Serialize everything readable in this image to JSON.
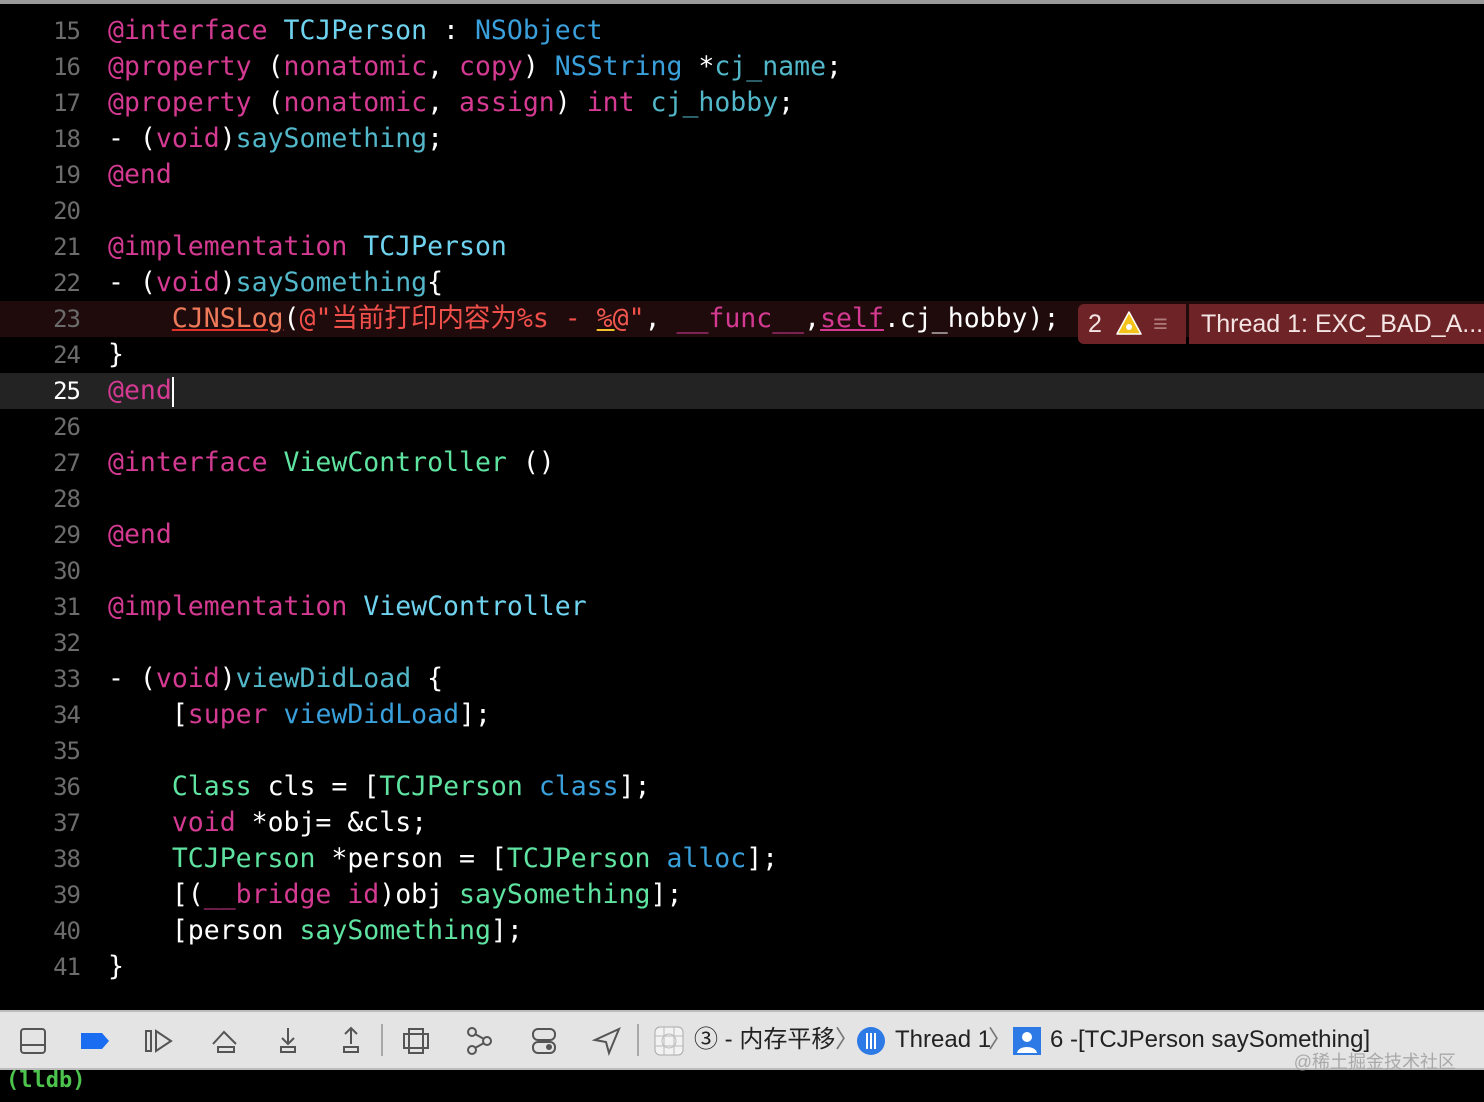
{
  "editor": {
    "lines": [
      {
        "n": "15",
        "t": [
          [
            "@interface ",
            "k"
          ],
          [
            "TCJPerson",
            "t"
          ],
          [
            " : ",
            "p"
          ],
          [
            "NSObject",
            "s"
          ]
        ]
      },
      {
        "n": "16",
        "t": [
          [
            "@property ",
            "k"
          ],
          [
            "(",
            "p"
          ],
          [
            "nonatomic",
            "k"
          ],
          [
            ", ",
            "p"
          ],
          [
            "copy",
            "k"
          ],
          [
            ") ",
            "p"
          ],
          [
            "NSString",
            "s"
          ],
          [
            " *",
            "p"
          ],
          [
            "cj_name",
            "m"
          ],
          [
            ";",
            "p"
          ]
        ]
      },
      {
        "n": "17",
        "t": [
          [
            "@property ",
            "k"
          ],
          [
            "(",
            "p"
          ],
          [
            "nonatomic",
            "k"
          ],
          [
            ", ",
            "p"
          ],
          [
            "assign",
            "k"
          ],
          [
            ") ",
            "p"
          ],
          [
            "int",
            "k"
          ],
          [
            " ",
            "p"
          ],
          [
            "cj_hobby",
            "m"
          ],
          [
            ";",
            "p"
          ]
        ]
      },
      {
        "n": "18",
        "t": [
          [
            "- (",
            "p"
          ],
          [
            "void",
            "k"
          ],
          [
            ")",
            "p"
          ],
          [
            "saySomething",
            "m"
          ],
          [
            ";",
            "p"
          ]
        ]
      },
      {
        "n": "19",
        "t": [
          [
            "@end",
            "k"
          ]
        ]
      },
      {
        "n": "20",
        "t": []
      },
      {
        "n": "21",
        "t": [
          [
            "@implementation ",
            "k"
          ],
          [
            "TCJPerson",
            "t"
          ]
        ]
      },
      {
        "n": "22",
        "t": [
          [
            "- (",
            "p"
          ],
          [
            "void",
            "k"
          ],
          [
            ")",
            "p"
          ],
          [
            "saySomething",
            "m"
          ],
          [
            "{",
            "p"
          ]
        ]
      },
      {
        "n": "23",
        "err": true,
        "t": [
          [
            "    ",
            "p"
          ],
          [
            "CJNSLog",
            "o"
          ],
          [
            "(",
            "p"
          ],
          [
            "@\"当前打印内容为%s - ",
            "r"
          ],
          [
            "%@",
            "y"
          ],
          [
            "\"",
            "r"
          ],
          [
            ", ",
            "p"
          ],
          [
            "__func__",
            "k"
          ],
          [
            ",",
            "p"
          ],
          [
            "self",
            "k u"
          ],
          [
            ".cj_hobby);",
            "p"
          ]
        ]
      },
      {
        "n": "24",
        "t": [
          [
            "}",
            "p"
          ]
        ]
      },
      {
        "n": "25",
        "cur": true,
        "t": [
          [
            "@end",
            "k"
          ]
        ]
      },
      {
        "n": "26",
        "t": []
      },
      {
        "n": "27",
        "t": [
          [
            "@interface ",
            "k"
          ],
          [
            "ViewController",
            "g"
          ],
          [
            " ()",
            "p"
          ]
        ]
      },
      {
        "n": "28",
        "t": []
      },
      {
        "n": "29",
        "t": [
          [
            "@end",
            "k"
          ]
        ]
      },
      {
        "n": "30",
        "t": []
      },
      {
        "n": "31",
        "t": [
          [
            "@implementation ",
            "k"
          ],
          [
            "ViewController",
            "t"
          ]
        ]
      },
      {
        "n": "32",
        "t": []
      },
      {
        "n": "33",
        "t": [
          [
            "- (",
            "p"
          ],
          [
            "void",
            "k"
          ],
          [
            ")",
            "p"
          ],
          [
            "viewDidLoad",
            "m"
          ],
          [
            " {",
            "p"
          ]
        ]
      },
      {
        "n": "34",
        "t": [
          [
            "    [",
            "p"
          ],
          [
            "super",
            "k"
          ],
          [
            " ",
            "p"
          ],
          [
            "viewDidLoad",
            "s"
          ],
          [
            "];",
            "p"
          ]
        ]
      },
      {
        "n": "35",
        "t": []
      },
      {
        "n": "36",
        "t": [
          [
            "    ",
            "p"
          ],
          [
            "Class",
            "g"
          ],
          [
            " cls = [",
            "p"
          ],
          [
            "TCJPerson",
            "g"
          ],
          [
            " ",
            "p"
          ],
          [
            "class",
            "s"
          ],
          [
            "];",
            "p"
          ]
        ]
      },
      {
        "n": "37",
        "t": [
          [
            "    ",
            "p"
          ],
          [
            "void",
            "k"
          ],
          [
            " *obj= &cls;",
            "p"
          ]
        ]
      },
      {
        "n": "38",
        "t": [
          [
            "    ",
            "p"
          ],
          [
            "TCJPerson",
            "g"
          ],
          [
            " *person = [",
            "p"
          ],
          [
            "TCJPerson",
            "g"
          ],
          [
            " ",
            "p"
          ],
          [
            "alloc",
            "s"
          ],
          [
            "];",
            "p"
          ]
        ]
      },
      {
        "n": "39",
        "t": [
          [
            "    [(",
            "p"
          ],
          [
            "__bridge",
            "k"
          ],
          [
            " ",
            "p"
          ],
          [
            "id",
            "k"
          ],
          [
            ")obj ",
            "p"
          ],
          [
            "saySomething",
            "g"
          ],
          [
            "];",
            "p"
          ]
        ]
      },
      {
        "n": "40",
        "t": [
          [
            "    [person ",
            "p"
          ],
          [
            "saySomething",
            "g"
          ],
          [
            "];",
            "p"
          ]
        ]
      },
      {
        "n": "41",
        "t": [
          [
            "}",
            "p"
          ]
        ]
      }
    ]
  },
  "issue": {
    "count": "2",
    "message": "Thread 1: EXC_BAD_A...",
    "warning_icon": "warning-triangle",
    "menu_icon": "hamburger"
  },
  "debugbar": {
    "breadcrumb": {
      "process": "③ - 内存平移",
      "thread": "Thread 1",
      "frame": "6 -[TCJPerson saySomething]"
    },
    "accent": "#1a6cf0",
    "watermark": "@稀土掘金技术社区"
  },
  "console": {
    "prompt": "(lldb)"
  }
}
